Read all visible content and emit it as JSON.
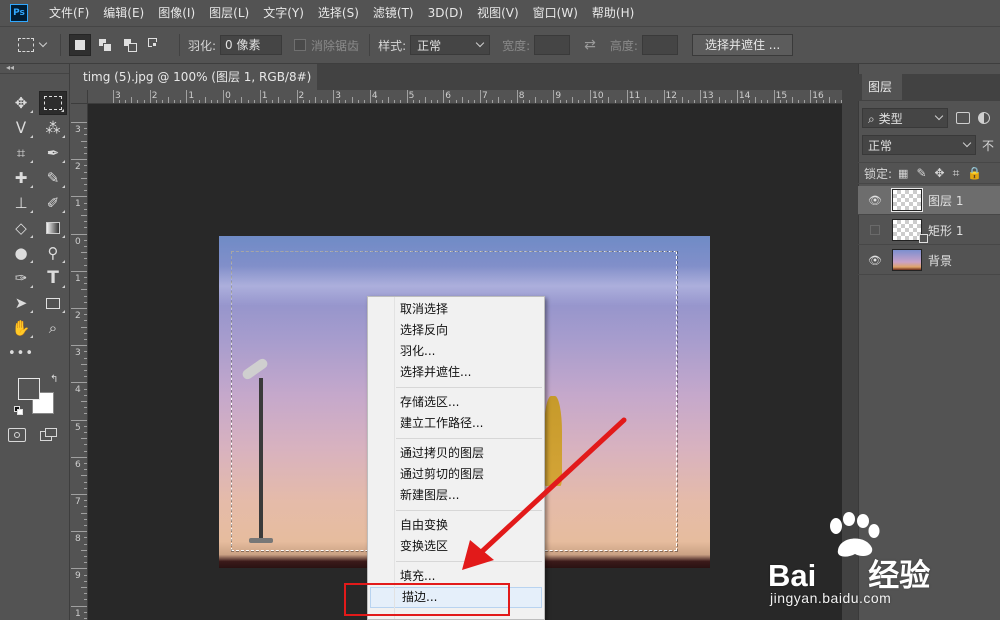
{
  "app": {
    "logo": "Ps",
    "menu": [
      "文件(F)",
      "编辑(E)",
      "图像(I)",
      "图层(L)",
      "文字(Y)",
      "选择(S)",
      "滤镜(T)",
      "3D(D)",
      "视图(V)",
      "窗口(W)",
      "帮助(H)"
    ]
  },
  "options_bar": {
    "feather_label": "羽化:",
    "feather_value": "0 像素",
    "antialias_label": "消除锯齿",
    "style_label": "样式:",
    "style_value": "正常",
    "width_label": "宽度:",
    "height_label": "高度:",
    "select_mask_button": "选择并遮住 ..."
  },
  "document": {
    "tab_title": "timg (5).jpg @ 100% (图层 1, RGB/8#) *",
    "close_glyph": "×",
    "ruler_h_labels": [
      "3",
      "2",
      "1",
      "0",
      "1",
      "2",
      "3",
      "4",
      "5",
      "6",
      "7",
      "8",
      "9",
      "10",
      "11",
      "12",
      "13",
      "14",
      "15",
      "16"
    ],
    "ruler_v_labels": [
      "3",
      "2",
      "1",
      "0",
      "1",
      "2",
      "3",
      "4",
      "5",
      "6",
      "7",
      "8",
      "9",
      "1"
    ]
  },
  "context_menu": {
    "groups": [
      [
        "取消选择",
        "选择反向",
        "羽化...",
        "选择并遮住..."
      ],
      [
        "存储选区...",
        "建立工作路径..."
      ],
      [
        "通过拷贝的图层",
        "通过剪切的图层",
        "新建图层..."
      ],
      [
        "自由变换",
        "变换选区"
      ],
      [
        "填充...",
        "描边..."
      ]
    ],
    "highlighted": "描边..."
  },
  "layers_panel": {
    "tab": "图层",
    "filter_label": "类型",
    "blend_mode": "正常",
    "opacity_label": "不",
    "lock_label": "锁定:",
    "layers": [
      {
        "name": "图层 1",
        "visible": true,
        "selected": true
      },
      {
        "name": "矩形 1",
        "visible": false,
        "selected": false
      },
      {
        "name": "背景",
        "visible": true,
        "selected": false
      }
    ]
  },
  "watermark": {
    "brand": "Bai",
    "brand_tail": "经验",
    "url": "jingyan.baidu.com"
  },
  "colors": {
    "accent_red": "#e21a1a",
    "ps_blue": "#31a8ff",
    "foreground": "#555555",
    "background": "#ffffff"
  }
}
